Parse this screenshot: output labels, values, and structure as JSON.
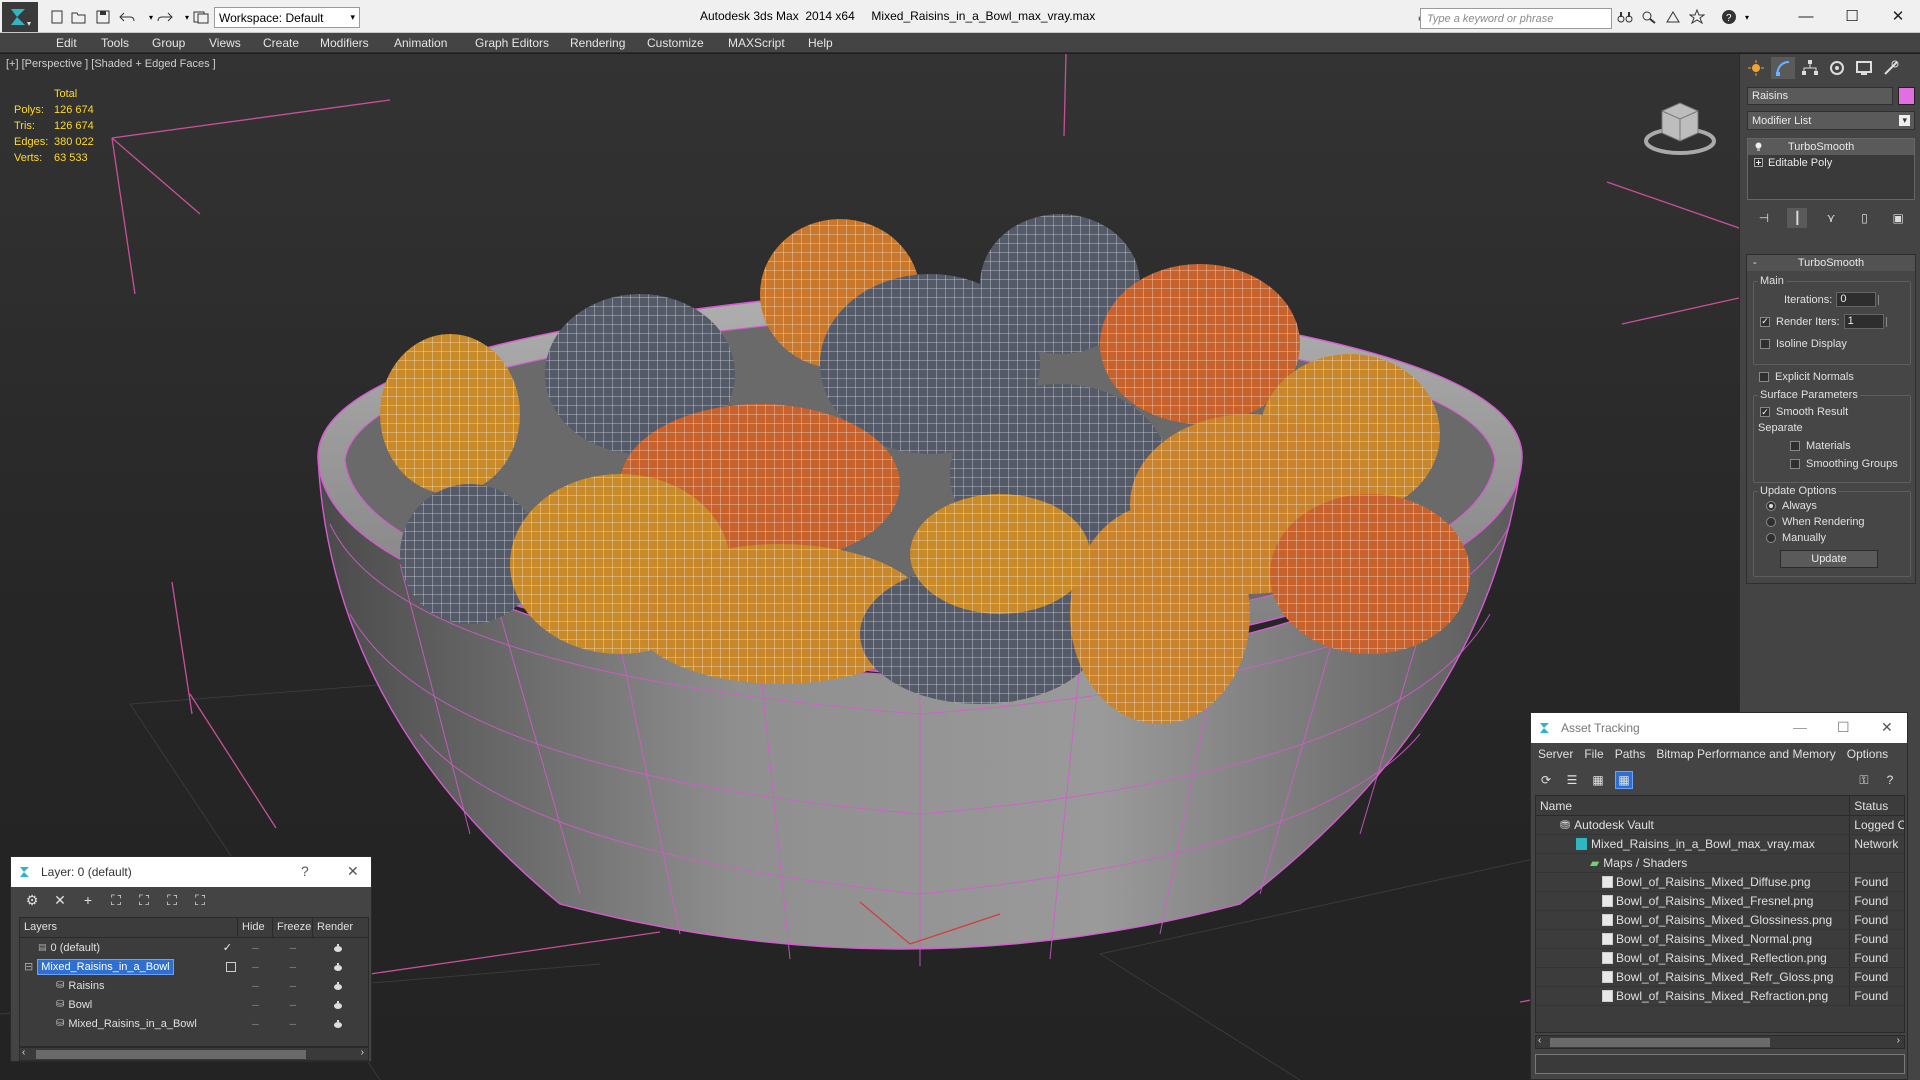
{
  "titlebar": {
    "workspace_label": "Workspace: Default",
    "title": "Autodesk 3ds Max  2014 x64     Mixed_Raisins_in_a_Bowl_max_vray.max",
    "search_placeholder": "Type a keyword or phrase",
    "minimize": "—",
    "maximize": "☐",
    "close": "✕"
  },
  "menu": [
    "Edit",
    "Tools",
    "Group",
    "Views",
    "Create",
    "Modifiers",
    "Animation",
    "Graph Editors",
    "Rendering",
    "Customize",
    "MAXScript",
    "Help"
  ],
  "viewport": {
    "label": "[+] [Perspective ] [Shaded + Edged Faces ]",
    "stats_header": "Total",
    "stats": [
      {
        "k": "Polys:",
        "v": "126 674"
      },
      {
        "k": "Tris:",
        "v": "126 674"
      },
      {
        "k": "Edges:",
        "v": "380 022"
      },
      {
        "k": "Verts:",
        "v": "63 533"
      }
    ]
  },
  "command_panel": {
    "object_name": "Raisins",
    "object_color": "#e36de3",
    "modifier_list": "Modifier List",
    "stack": [
      {
        "label": "TurboSmooth",
        "selected": true
      },
      {
        "label": "Editable Poly",
        "selected": false
      }
    ],
    "rollout_title": "TurboSmooth",
    "main_group": "Main",
    "iterations_label": "Iterations:",
    "iterations_value": "0",
    "render_iters_label": "Render Iters:",
    "render_iters_value": "1",
    "isoline": "Isoline Display",
    "explicit_normals": "Explicit Normals",
    "surface_group": "Surface Parameters",
    "smooth_result": "Smooth Result",
    "separate": "Separate",
    "materials": "Materials",
    "smoothing_groups": "Smoothing Groups",
    "update_group": "Update Options",
    "always": "Always",
    "when_rendering": "When Rendering",
    "manually": "Manually",
    "update_button": "Update"
  },
  "layer_dialog": {
    "title": "Layer: 0 (default)",
    "help": "?",
    "close": "✕",
    "columns": [
      "Layers",
      "Hide",
      "Freeze",
      "Render"
    ],
    "rows": [
      {
        "name": "0 (default)",
        "indent": 1,
        "selected": false
      },
      {
        "name": "Mixed_Raisins_in_a_Bowl",
        "indent": 1,
        "selected": true
      },
      {
        "name": "Raisins",
        "indent": 2,
        "selected": false
      },
      {
        "name": "Bowl",
        "indent": 2,
        "selected": false
      },
      {
        "name": "Mixed_Raisins_in_a_Bowl",
        "indent": 2,
        "selected": false
      }
    ]
  },
  "asset_dialog": {
    "title": "Asset Tracking",
    "minimize": "—",
    "maximize": "☐",
    "close": "✕",
    "menu": [
      "Server",
      "File",
      "Paths",
      "Bitmap Performance and Memory",
      "Options"
    ],
    "columns": [
      "Name",
      "Status"
    ],
    "rows": [
      {
        "name": "Autodesk Vault",
        "status": "Logged O",
        "indent": 1
      },
      {
        "name": "Mixed_Raisins_in_a_Bowl_max_vray.max",
        "status": "Network",
        "indent": 2
      },
      {
        "name": "Maps / Shaders",
        "status": "",
        "indent": 3
      },
      {
        "name": "Bowl_of_Raisins_Mixed_Diffuse.png",
        "status": "Found",
        "indent": 4
      },
      {
        "name": "Bowl_of_Raisins_Mixed_Fresnel.png",
        "status": "Found",
        "indent": 4
      },
      {
        "name": "Bowl_of_Raisins_Mixed_Glossiness.png",
        "status": "Found",
        "indent": 4
      },
      {
        "name": "Bowl_of_Raisins_Mixed_Normal.png",
        "status": "Found",
        "indent": 4
      },
      {
        "name": "Bowl_of_Raisins_Mixed_Reflection.png",
        "status": "Found",
        "indent": 4
      },
      {
        "name": "Bowl_of_Raisins_Mixed_Refr_Gloss.png",
        "status": "Found",
        "indent": 4
      },
      {
        "name": "Bowl_of_Raisins_Mixed_Refraction.png",
        "status": "Found",
        "indent": 4
      }
    ]
  }
}
